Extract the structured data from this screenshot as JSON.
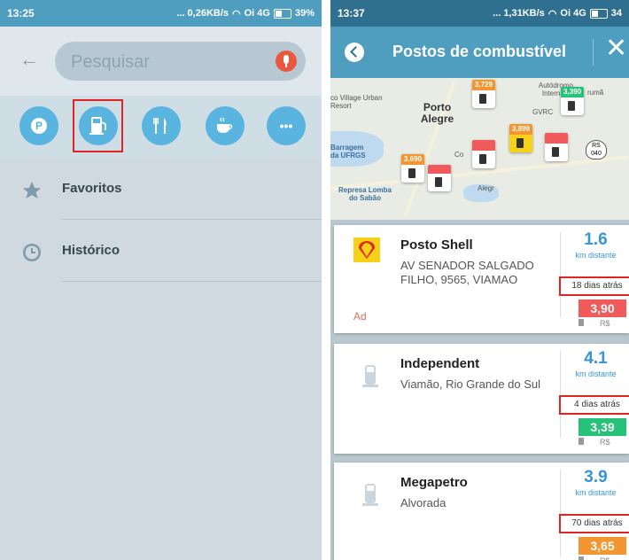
{
  "left": {
    "status": {
      "time": "13:25",
      "speed": "... 0,26KB/s",
      "network": "Oi 4G",
      "battery": "39%"
    },
    "search": {
      "placeholder": "Pesquisar"
    },
    "categories": [
      "parking-icon",
      "gas-station-icon",
      "restaurant-icon",
      "coffee-icon",
      "more-icon"
    ],
    "parking_letter": "P",
    "more_label": "•••",
    "list": [
      {
        "icon": "star-icon",
        "label": "Favoritos"
      },
      {
        "icon": "clock-icon",
        "label": "Histórico"
      }
    ]
  },
  "right": {
    "status": {
      "time": "13:37",
      "speed": "... 1,31KB/s",
      "network": "Oi 4G",
      "battery": "34"
    },
    "header": {
      "title": "Postos de combustível",
      "close": "✕"
    },
    "map": {
      "labels": {
        "village": "co Village Urban Resort",
        "porto": "Porto Alegre",
        "aeroporto": "Autódromo Internacio",
        "tarumã": "rumã",
        "gvrc": "GVRC",
        "barragem": "Barragem da UFRGS",
        "represa": "Represa Lomba do Sabão",
        "co": "Co",
        "alegr": "Alegr",
        "rs": "RS 040"
      },
      "pins": [
        {
          "price": "3,729",
          "color": "#f39530"
        },
        {
          "price": "3,390",
          "color": "#27c27a"
        },
        {
          "price": "3,899",
          "color": "#f39530"
        },
        {
          "price": "3,690",
          "color": "#f39530"
        }
      ]
    },
    "stations": [
      {
        "name": "Posto Shell",
        "address": "AV SENADOR SALGADO FILHO, 9565, VIAMAO",
        "distance": "1.6",
        "distance_label": "km distante",
        "updated": "18 dias atrás",
        "price": "3,90",
        "price_color": "#f05a5a",
        "currency": "R$",
        "ad": "Ad"
      },
      {
        "name": "Independent",
        "address": "Viamão, Rio Grande do Sul",
        "distance": "4.1",
        "distance_label": "km distante",
        "updated": "4 dias atrás",
        "price": "3,39",
        "price_color": "#27c27a",
        "currency": "R$"
      },
      {
        "name": "Megapetro",
        "address": "Alvorada",
        "distance": "3.9",
        "distance_label": "km distante",
        "updated": "70 dias atrás",
        "price": "3,65",
        "price_color": "#f39530",
        "currency": "R$"
      }
    ]
  }
}
